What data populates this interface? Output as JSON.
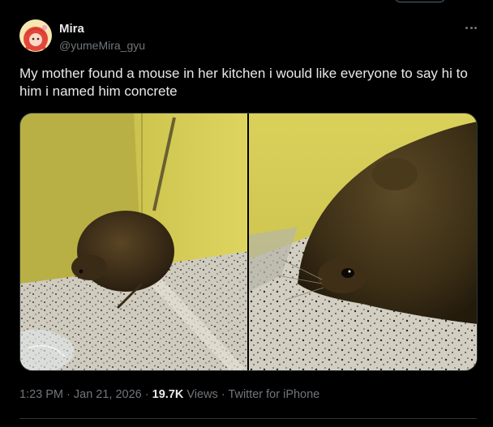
{
  "author": {
    "display_name": "Mira",
    "handle": "@yumeMira_gyu"
  },
  "tweet": {
    "text": "My mother found a mouse in her kitchen i would like everyone to say hi to him i named him concrete"
  },
  "meta": {
    "time": "1:23 PM",
    "separator1": " · ",
    "date": "Jan 21, 2026",
    "separator2": " · ",
    "views_count": "19.7K",
    "views_label": " Views",
    "separator3": " · ",
    "source": "Twitter for iPhone"
  },
  "icons": {
    "more": "more-horizontal-icon"
  },
  "colors": {
    "background": "#000000",
    "text_primary": "#e7e9ea",
    "text_secondary": "#71767b",
    "border": "#2f3336"
  }
}
